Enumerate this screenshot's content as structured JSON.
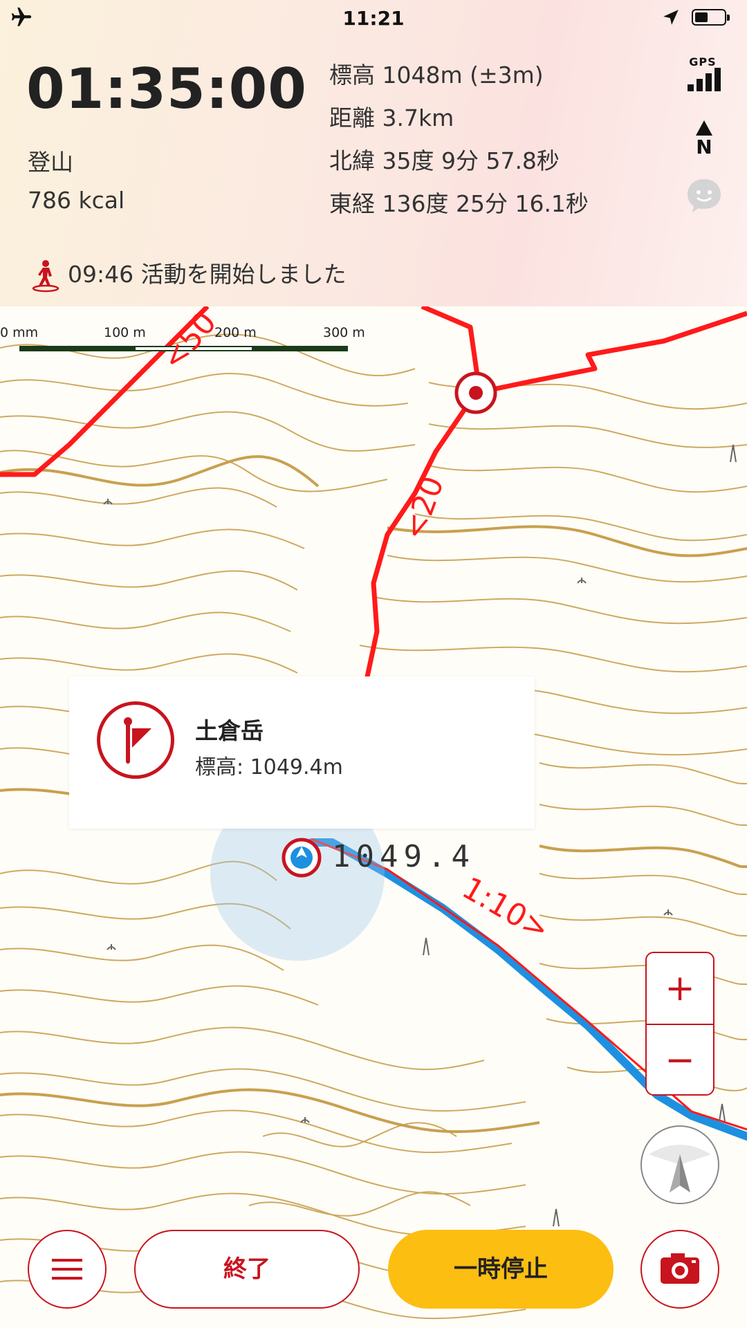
{
  "status_bar": {
    "time": "11:21"
  },
  "header": {
    "elapsed_time": "01:35:00",
    "activity_type": "登山",
    "calories": "786 kcal",
    "altitude": "標高 1048m (±3m)",
    "distance": "距離 3.7km",
    "latitude": "北緯 35度 9分 57.8秒",
    "longitude": "東経 136度 25分 16.1秒",
    "gps_label": "GPS",
    "north_label": "N",
    "event_text": "09:46 活動を開始しました"
  },
  "map": {
    "scale_labels": [
      "0 mm",
      "100 m",
      "200 m",
      "300 m"
    ],
    "route_labels": [
      "<50",
      "<20",
      "1:10>"
    ],
    "spot_height": "1049.4"
  },
  "popup": {
    "name": "土倉岳",
    "elevation": "標高: 1049.4m"
  },
  "controls": {
    "zoom_in": "+",
    "zoom_out": "−",
    "end_label": "終了",
    "pause_label": "一時停止"
  },
  "colors": {
    "accent_red": "#c8141e",
    "route_red": "#ff1a1a",
    "track_blue": "#1e90e0",
    "contour": "#c8a050",
    "pause_yellow": "#fdbe12"
  },
  "icons": [
    "airplane-icon",
    "location-arrow-icon",
    "battery-icon",
    "gps-signal-icon",
    "north-arrow-icon",
    "face-icon",
    "hiker-icon",
    "summit-flag-icon",
    "menu-icon",
    "camera-icon",
    "compass-icon"
  ]
}
